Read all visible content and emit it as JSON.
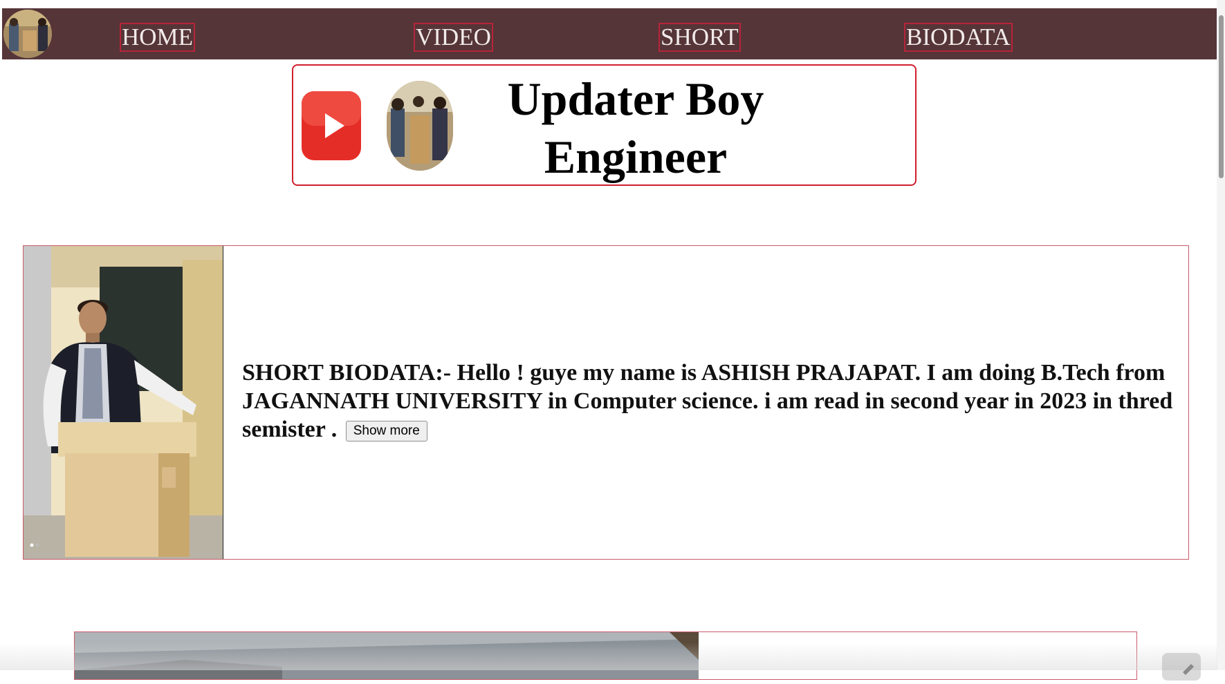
{
  "nav": {
    "items": [
      {
        "label": "HOME"
      },
      {
        "label": "VIDEO"
      },
      {
        "label": "SHORT"
      },
      {
        "label": "BIODATA"
      }
    ],
    "logo_icon": "profile-photo-icon",
    "background": "#553538"
  },
  "banner": {
    "title_line1": "Updater Boy",
    "title_line2": "Engineer",
    "play_icon": "youtube-icon",
    "border_color": "#d01f2e"
  },
  "bio": {
    "text": "SHORT BIODATA:- Hello ! guye my name is ASHISH PRAJAPAT. I am doing B.Tech from JAGANNATH UNIVERSITY in Computer science. i am read in second year in 2023 in thred semister .",
    "show_more_label": "Show more"
  }
}
